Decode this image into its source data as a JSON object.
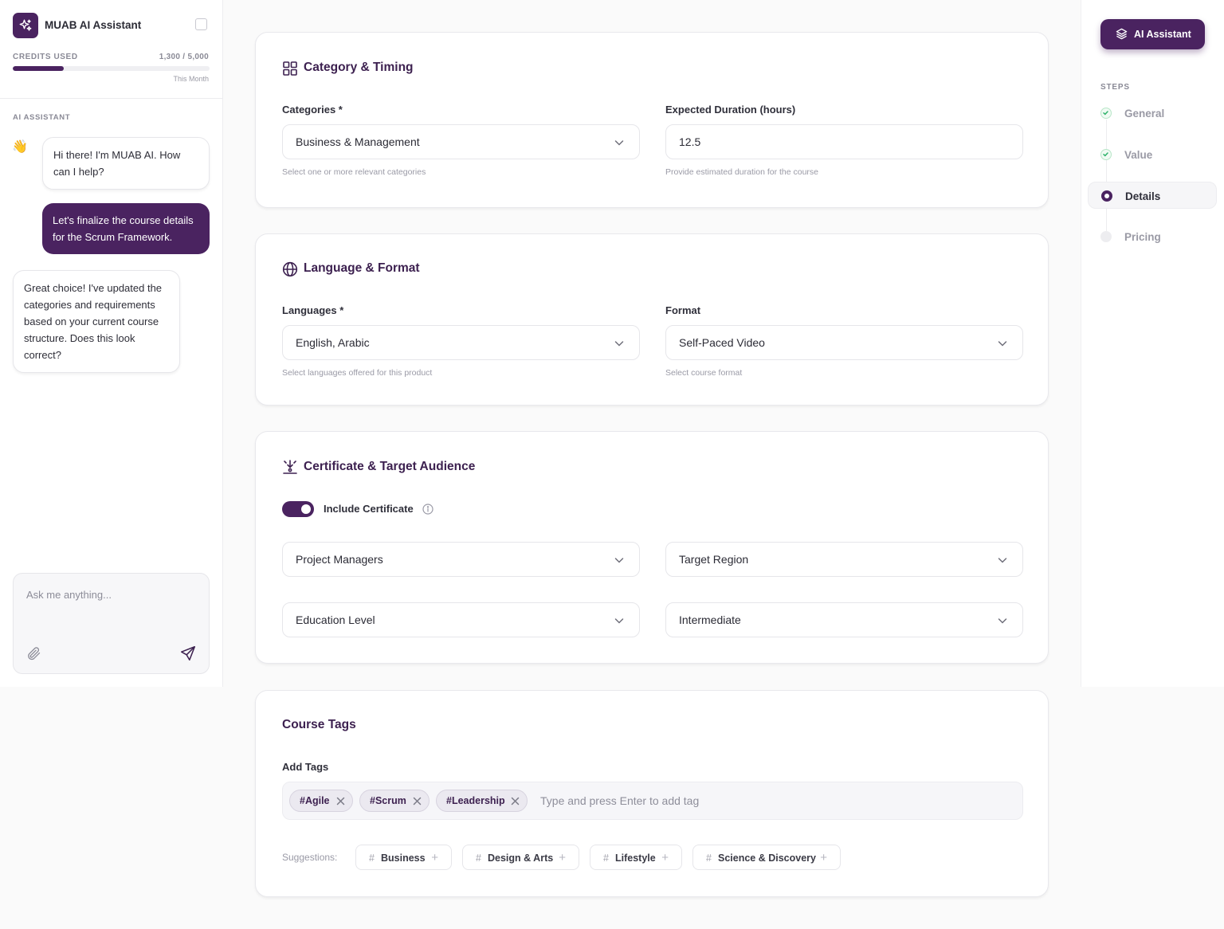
{
  "sidebar": {
    "app_title": "MUAB AI Assistant",
    "credits_label": "CREDITS USED",
    "credits_value": "1,300 / 5,000",
    "credits_fraction": 0.26,
    "credits_period": "This Month",
    "section_label": "AI ASSISTANT",
    "wave_emoji": "👋",
    "messages": [
      {
        "role": "ai",
        "text": "Hi there! I'm MUAB AI. How can I help?"
      },
      {
        "role": "user",
        "text": "Let's finalize the course details for the Scrum Framework."
      },
      {
        "role": "ai",
        "text": "Great choice! I've updated the categories and requirements based on your current course structure. Does this look correct?"
      }
    ],
    "chat_placeholder": "Ask me anything..."
  },
  "category_timing": {
    "title": "Category & Timing",
    "categories_label": "Categories *",
    "categories_value": "Business & Management",
    "categories_hint": "Select one or more relevant categories",
    "duration_label": "Expected Duration (hours)",
    "duration_value": "12.5",
    "duration_hint": "Provide estimated duration for the course"
  },
  "language_format": {
    "title": "Language & Format",
    "languages_label": "Languages *",
    "languages_value": "English, Arabic",
    "languages_hint": "Select languages offered for this product",
    "format_label": "Format",
    "format_value": "Self-Paced Video",
    "format_hint": "Select course format"
  },
  "certificate": {
    "title": "Certificate & Target Audience",
    "include_label": "Include Certificate",
    "include_on": true,
    "audience_value": "Project Managers",
    "region_value": "Target Region",
    "education_value": "Education Level",
    "level_value": "Intermediate"
  },
  "tags": {
    "title": "Course Tags",
    "add_label": "Add Tags",
    "items": [
      "#Agile",
      "#Scrum",
      "#Leadership"
    ],
    "placeholder": "Type and press Enter to add tag",
    "suggestions_label": "Suggestions:",
    "suggestions": [
      "Business",
      "Design & Arts",
      "Lifestyle",
      "Science & Discovery"
    ]
  },
  "rail": {
    "ai_button": "AI Assistant",
    "steps_label": "STEPS",
    "steps": [
      {
        "name": "General",
        "state": "done"
      },
      {
        "name": "Value",
        "state": "done"
      },
      {
        "name": "Details",
        "state": "current"
      },
      {
        "name": "Pricing",
        "state": "todo"
      }
    ]
  },
  "colors": {
    "accent": "#4a2360",
    "done_green": "#2fb36b"
  }
}
